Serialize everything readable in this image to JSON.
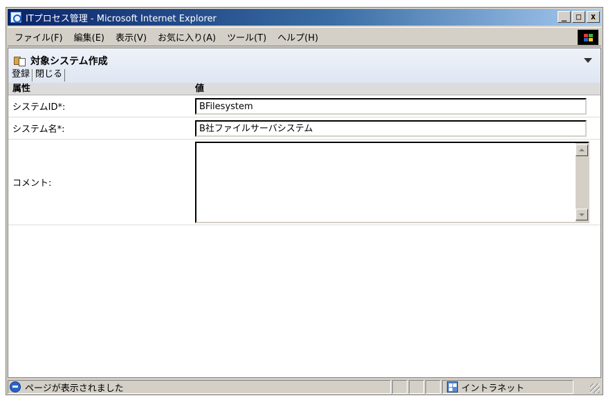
{
  "window": {
    "title": "ITプロセス管理 - Microsoft Internet Explorer",
    "buttons": {
      "minimize": "_",
      "maximize": "□",
      "close": "x"
    }
  },
  "menu": {
    "items": [
      "ファイル(F)",
      "編集(E)",
      "表示(V)",
      "お気に入り(A)",
      "ツール(T)",
      "ヘルプ(H)"
    ]
  },
  "page": {
    "title": "対象システム作成",
    "toolbar": {
      "register": "登録",
      "close": "閉じる"
    },
    "table": {
      "headers": {
        "attribute": "属性",
        "value": "値"
      },
      "rows": [
        {
          "label": "システムID*:",
          "value": "BFilesystem"
        },
        {
          "label": "システム名*:",
          "value": "B社ファイルサーバシステム"
        },
        {
          "label": "コメント:",
          "value": ""
        }
      ]
    }
  },
  "statusbar": {
    "message": "ページが表示されました",
    "zone": "イントラネット"
  },
  "colors": {
    "titlebar_start": "#0a246a",
    "titlebar_end": "#a6caf0",
    "chrome": "#d4d0c8",
    "header_band": "#dfe6f2"
  }
}
